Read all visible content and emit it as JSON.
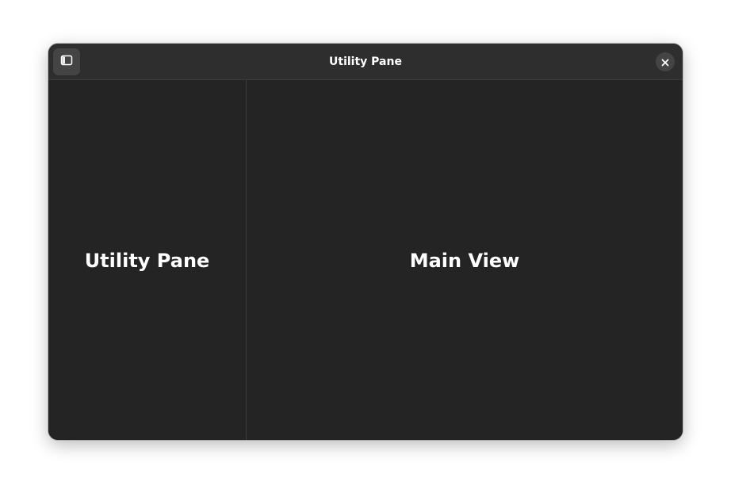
{
  "window": {
    "title": "Utility Pane"
  },
  "headerbar": {
    "sidebar_toggle_icon": "sidebar-show-icon",
    "close_icon": "close-icon"
  },
  "utility_pane": {
    "heading": "Utility Pane"
  },
  "main_view": {
    "heading": "Main View"
  },
  "colors": {
    "window_bg": "#242424",
    "headerbar_bg": "#2e2e2e",
    "button_bg": "#444444",
    "text": "#ffffff",
    "divider": "#3c3c3c"
  }
}
